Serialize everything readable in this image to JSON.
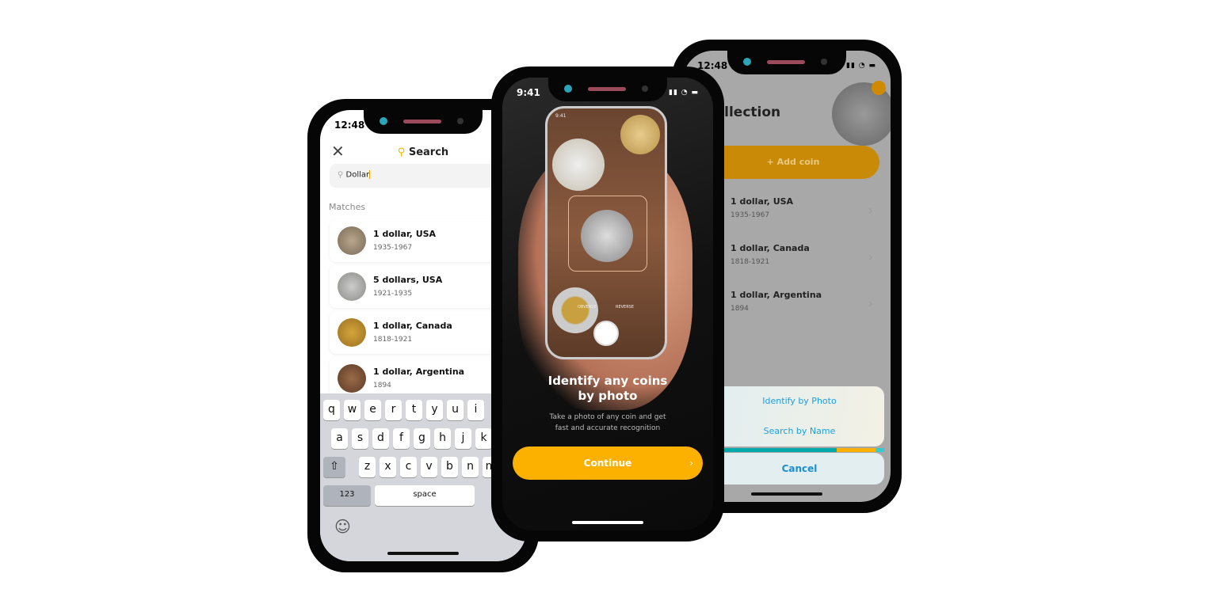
{
  "left_phone": {
    "time": "12:48",
    "status": "••••",
    "header": {
      "icon": "search-icon",
      "title": "Search"
    },
    "search": {
      "value": "Dollar"
    },
    "matches_label": "Matches",
    "items": [
      {
        "name": "1 dollar, USA",
        "years": "1935-1967",
        "color": "#9c8a72"
      },
      {
        "name": "5 dollars, USA",
        "years": "1921-1935",
        "color": "#a9a9a4"
      },
      {
        "name": "1 dollar, Canada",
        "years": "1818-1921",
        "color": "#b88a2c"
      },
      {
        "name": "1 dollar, Argentina",
        "years": "1894",
        "color": "#7a5238"
      }
    ],
    "keyboard": {
      "row1": [
        "q",
        "w",
        "e",
        "r",
        "t",
        "y",
        "u",
        "i"
      ],
      "row2": [
        "a",
        "s",
        "d",
        "f",
        "g",
        "h",
        "j",
        "k"
      ],
      "row3": [
        "z",
        "x",
        "c",
        "v",
        "b",
        "n",
        "m"
      ],
      "shift": "⇧",
      "numbers": "123",
      "space": "space",
      "emoji": "☺",
      "mic": "🎙"
    }
  },
  "center_phone": {
    "time": "9:41",
    "inner": {
      "time": "9:41",
      "obverse": "OBVERSE",
      "reverse": "REVERSE"
    },
    "title_line1": "Identify any coins",
    "title_line2": "by photo",
    "subtitle_line1": "Take a photo of any coin and get",
    "subtitle_line2": "fast and accurate recognition",
    "continue_label": "Continue",
    "accent": "#fcb000"
  },
  "right_phone": {
    "time": "12:48",
    "title": "Collection",
    "add_label": "+ Add coin",
    "items": [
      {
        "name": "1 dollar, USA",
        "years": "1935-1967"
      },
      {
        "name": "1 dollar, Canada",
        "years": "1818-1921"
      },
      {
        "name": "1 dollar, Argentina",
        "years": "1894"
      }
    ],
    "sheet": {
      "identify": "Identify by Photo",
      "search": "Search by Name",
      "cancel": "Cancel"
    }
  }
}
